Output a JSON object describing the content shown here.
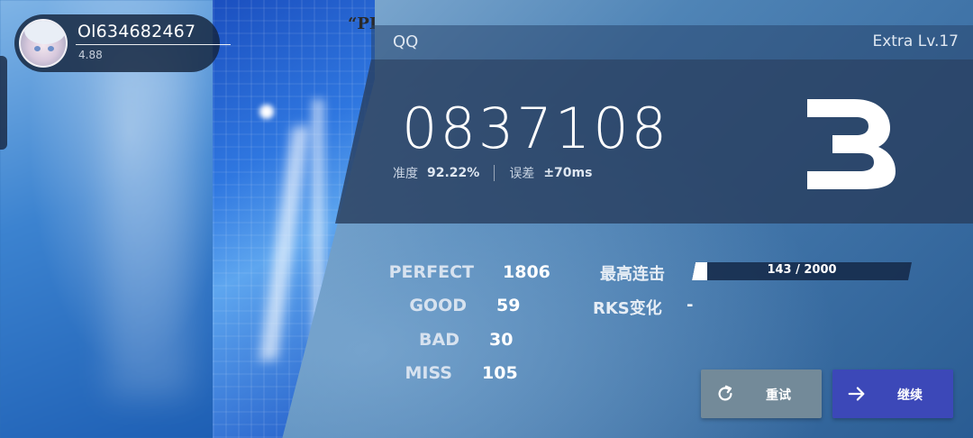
{
  "player": {
    "name": "Ol634682467",
    "rks": "4.88"
  },
  "song": {
    "title": "QQ",
    "difficulty": "Extra Lv.17"
  },
  "result": {
    "score": "0837108",
    "accuracy_label": "准度",
    "accuracy_value": "92.22%",
    "error_label": "误差",
    "error_value": "±70ms",
    "grade": "B"
  },
  "stats": {
    "perfect_label": "PERFECT",
    "perfect_value": "1806",
    "good_label": "GOOD",
    "good_value": "59",
    "bad_label": "BAD",
    "bad_value": "30",
    "miss_label": "MISS",
    "miss_value": "105"
  },
  "combo": {
    "label": "最高连击",
    "text": "143 / 2000",
    "fraction": 0.0715
  },
  "rks_change": {
    "label": "RKS变化",
    "value": "-"
  },
  "buttons": {
    "retry_label": "重试",
    "continue_label": "继续"
  },
  "illustration": {
    "quote_text": "“PI"
  },
  "colors": {
    "retry_button": "#738a99",
    "continue_button": "#3c48b8",
    "panel": "#283e5f"
  },
  "icons": {
    "retry": "retry-icon",
    "continue": "arrow-right-icon"
  }
}
